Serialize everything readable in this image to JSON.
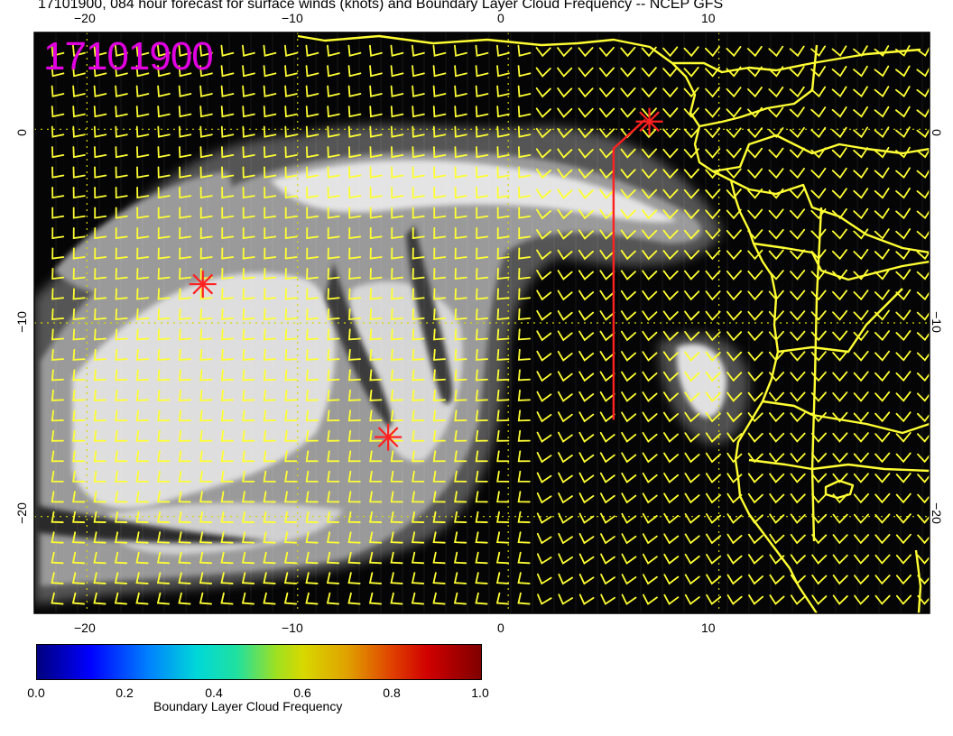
{
  "title": "17101900, 084 hour forecast for surface winds (knots) and Boundary Layer Cloud Frequency -- NCEP GFS",
  "stamp": "17101900",
  "axes": {
    "x_ticks": [
      "−20",
      "−10",
      "0",
      "10"
    ],
    "y_ticks": [
      "0",
      "−10",
      "−20"
    ]
  },
  "colorbar": {
    "label": "Boundary Layer Cloud Frequency",
    "ticks": [
      "0.0",
      "0.2",
      "0.4",
      "0.6",
      "0.8",
      "1.0"
    ]
  },
  "colors": {
    "ocean_clear": "#050505",
    "cloud_low": "#4a4a4a",
    "cloud_mid": "#8a8a8a",
    "cloud_high": "#dcdcdc",
    "coast": "#ffff33",
    "barb": "#ffff33",
    "marker": "#ff2020",
    "stamp": "#e000e0",
    "grid": "#d8d800"
  },
  "markers": [
    {
      "name": "star-marker-north",
      "lon": 6.7,
      "lat": 0.4
    },
    {
      "name": "star-marker-west",
      "lon": -14.5,
      "lat": -8.0
    },
    {
      "name": "star-marker-south",
      "lon": -5.7,
      "lat": -15.9
    }
  ],
  "flight_track": [
    [
      6.5,
      0.5
    ],
    [
      5.0,
      -1.0
    ],
    [
      5.0,
      -15.0
    ]
  ],
  "map_extent": {
    "lon_min": -22.5,
    "lon_max": 20,
    "lat_min": -25,
    "lat_max": 5
  }
}
